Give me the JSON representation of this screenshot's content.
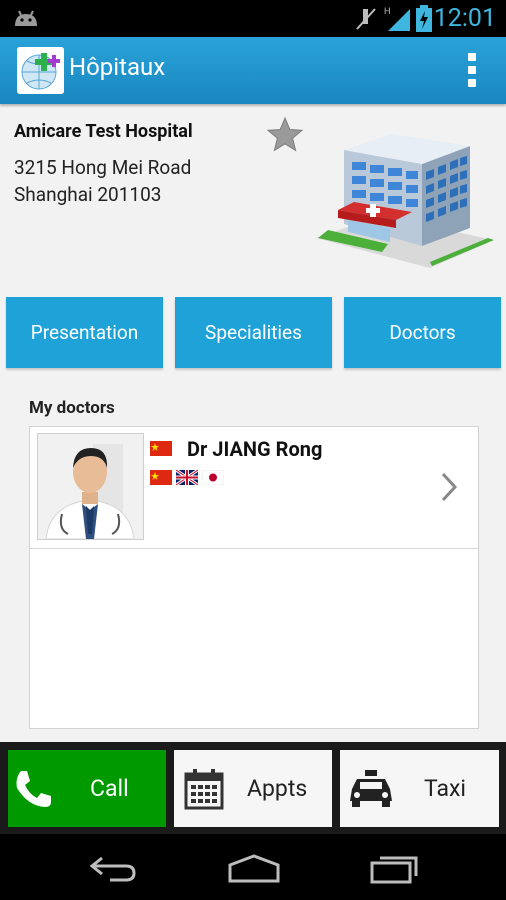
{
  "status_bar": {
    "time": "12:01"
  },
  "action_bar": {
    "title": "Hôpitaux",
    "logo_icon": "app-logo-icon",
    "menu_icon": "overflow-menu-icon"
  },
  "hospital": {
    "name": "Amicare Test Hospital",
    "address_line1": "3215 Hong Mei Road",
    "address_line2": "Shanghai 201103",
    "favorite_icon": "star-icon",
    "image_icon": "hospital-building-icon"
  },
  "tabs": [
    {
      "label": "Presentation"
    },
    {
      "label": "Specialities"
    },
    {
      "label": "Doctors"
    }
  ],
  "my_doctors": {
    "label": "My doctors",
    "doctors": [
      {
        "name": "Dr JIANG Rong",
        "nationality_flag": "china-flag-icon",
        "languages": [
          "china-flag-icon",
          "uk-flag-icon",
          "japan-flag-icon"
        ]
      }
    ]
  },
  "actions": {
    "call": {
      "label": "Call",
      "icon": "phone-icon"
    },
    "appts": {
      "label": "Appts",
      "icon": "calendar-icon"
    },
    "taxi": {
      "label": "Taxi",
      "icon": "taxi-icon"
    }
  },
  "colors": {
    "accent": "#1ea2d8",
    "call_green": "#009900",
    "action_bar": "#1a8fc8"
  }
}
